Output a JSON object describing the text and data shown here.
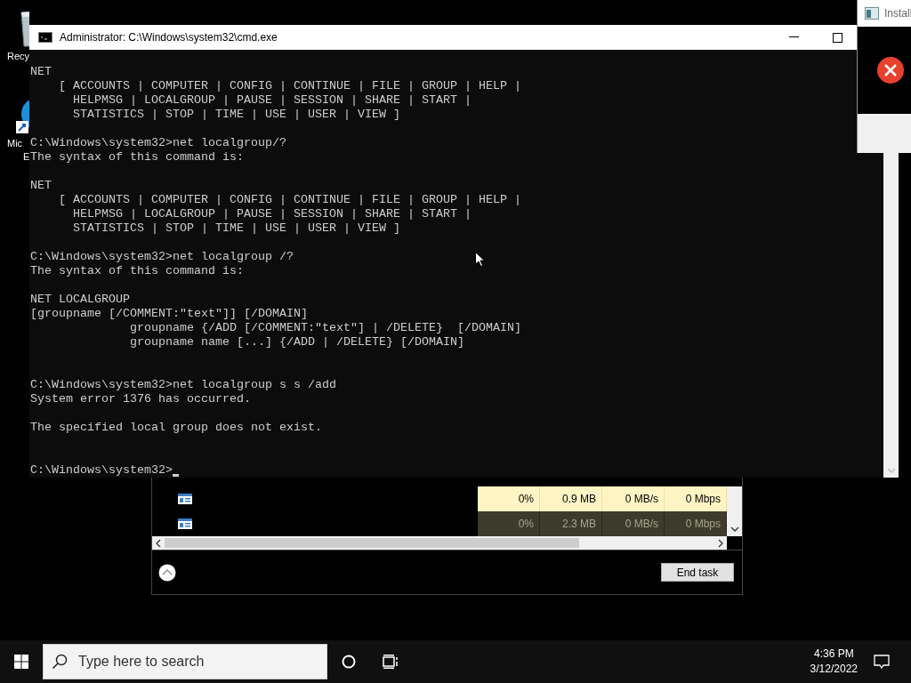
{
  "desktop_icons": [
    {
      "kind": "bin",
      "label": "Recy"
    },
    {
      "kind": "browser",
      "label": "Mic",
      "label_2": "E"
    }
  ],
  "installer_window": {
    "title": "Install"
  },
  "task_manager": {
    "rows": [
      {
        "dimmed": false,
        "cells": [
          "0%",
          "0.9 MB",
          "0 MB/s",
          "0 Mbps"
        ]
      },
      {
        "dimmed": true,
        "cells": [
          "0%",
          "2.3 MB",
          "0 MB/s",
          "0 Mbps"
        ]
      }
    ],
    "end_task_button": "End task"
  },
  "console_window": {
    "title": "Administrator: C:\\Windows\\system32\\cmd.exe",
    "lines": [
      {
        "kind": "text",
        "text": "NET"
      },
      {
        "kind": "text",
        "text": "    [ ACCOUNTS | COMPUTER | CONFIG | CONTINUE | FILE | GROUP | HELP |"
      },
      {
        "kind": "text",
        "text": "      HELPMSG | LOCALGROUP | PAUSE | SESSION | SHARE | START |"
      },
      {
        "kind": "text",
        "text": "      STATISTICS | STOP | TIME | USE | USER | VIEW ]"
      },
      {
        "kind": "blank"
      },
      {
        "kind": "text",
        "text": "C:\\Windows\\system32>net localgroup/?"
      },
      {
        "kind": "text",
        "text": "The syntax of this command is:"
      },
      {
        "kind": "blank"
      },
      {
        "kind": "text",
        "text": "NET"
      },
      {
        "kind": "text",
        "text": "    [ ACCOUNTS | COMPUTER | CONFIG | CONTINUE | FILE | GROUP | HELP |"
      },
      {
        "kind": "text",
        "text": "      HELPMSG | LOCALGROUP | PAUSE | SESSION | SHARE | START |"
      },
      {
        "kind": "text",
        "text": "      STATISTICS | STOP | TIME | USE | USER | VIEW ]"
      },
      {
        "kind": "blank"
      },
      {
        "kind": "text",
        "text": "C:\\Windows\\system32>net localgroup /?"
      },
      {
        "kind": "text",
        "text": "The syntax of this command is:"
      },
      {
        "kind": "blank"
      },
      {
        "kind": "text",
        "text": "NET LOCALGROUP"
      },
      {
        "kind": "text",
        "text": "[groupname [/COMMENT:\"text\"]] [/DOMAIN]"
      },
      {
        "kind": "text",
        "text": "              groupname {/ADD [/COMMENT:\"text\"] | /DELETE}  [/DOMAIN]"
      },
      {
        "kind": "text",
        "text": "              groupname name [...] {/ADD | /DELETE} [/DOMAIN]"
      },
      {
        "kind": "blank"
      },
      {
        "kind": "blank"
      },
      {
        "kind": "text",
        "text": "C:\\Windows\\system32>net localgroup s s /add"
      },
      {
        "kind": "text",
        "text": "System error 1376 has occurred."
      },
      {
        "kind": "blank"
      },
      {
        "kind": "text",
        "text": "The specified local group does not exist."
      },
      {
        "kind": "blank"
      },
      {
        "kind": "blank"
      },
      {
        "kind": "prompt",
        "text": "C:\\Windows\\system32>"
      }
    ]
  },
  "taskbar": {
    "search": {
      "placeholder": "Type here to search"
    },
    "time": "4:36 PM",
    "date": "3/12/2022"
  }
}
